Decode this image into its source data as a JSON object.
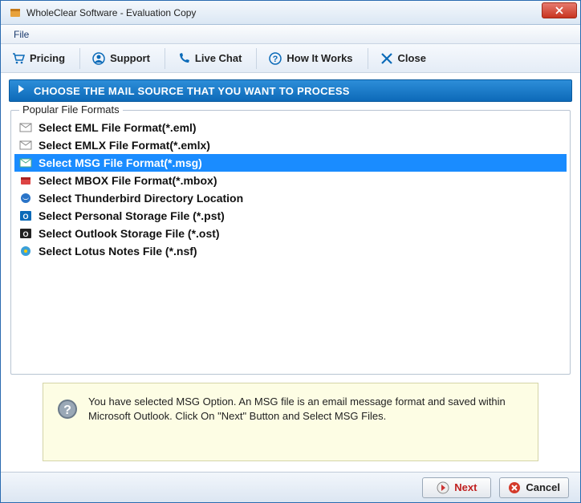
{
  "titlebar": {
    "title": "WholeClear Software - Evaluation Copy"
  },
  "menubar": {
    "file": "File"
  },
  "toolbar": {
    "pricing": "Pricing",
    "support": "Support",
    "livechat": "Live Chat",
    "howitworks": "How It Works",
    "close": "Close"
  },
  "banner": {
    "text": "CHOOSE THE MAIL SOURCE THAT YOU WANT TO PROCESS"
  },
  "fieldset": {
    "legend": "Popular File Formats"
  },
  "formats": {
    "eml": "Select EML File Format(*.eml)",
    "emlx": "Select EMLX File Format(*.emlx)",
    "msg": "Select MSG File Format(*.msg)",
    "mbox": "Select MBOX File Format(*.mbox)",
    "thunderbird": "Select Thunderbird Directory Location",
    "pst": "Select Personal Storage File (*.pst)",
    "ost": "Select Outlook Storage File (*.ost)",
    "nsf": "Select Lotus Notes File (*.nsf)",
    "selected": "msg"
  },
  "info": {
    "text": "You have selected MSG Option. An MSG file is an email message format and saved within Microsoft Outlook. Click On \"Next\" Button and Select MSG Files."
  },
  "footer": {
    "next": "Next",
    "cancel": "Cancel"
  }
}
